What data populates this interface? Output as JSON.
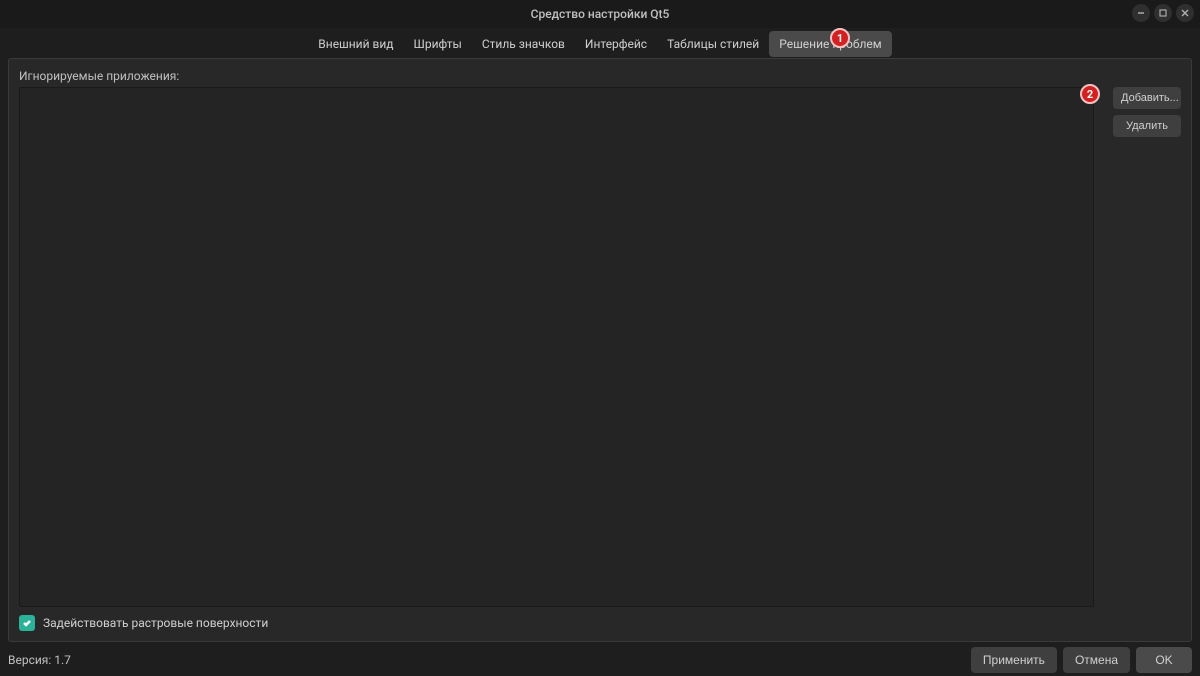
{
  "window": {
    "title": "Средство настройки Qt5"
  },
  "tabs": {
    "appearance": "Внешний вид",
    "fonts": "Шрифты",
    "icon_style": "Стиль значков",
    "interface": "Интерфейс",
    "stylesheets": "Таблицы стилей",
    "troubleshoot": "Решение проблем"
  },
  "section": {
    "ignored_apps_label": "Игнорируемые приложения:"
  },
  "buttons": {
    "add": "Добавить...",
    "delete": "Удалить",
    "apply": "Применить",
    "cancel": "Отмена",
    "ok": "OK"
  },
  "checkbox": {
    "raster_surfaces": "Задействовать растровые поверхности"
  },
  "footer": {
    "version": "Версия: 1.7"
  },
  "annotations": {
    "badge1": "1",
    "badge2": "2"
  }
}
